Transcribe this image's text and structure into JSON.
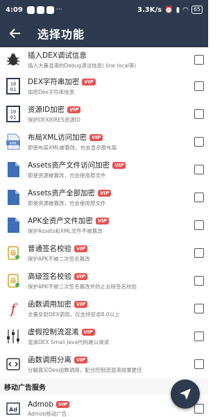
{
  "status": {
    "time": "4:09",
    "net_speed": "3.3K/s",
    "battery": "65"
  },
  "appbar": {
    "title": "选择功能"
  },
  "items": [
    {
      "title": "插入DEX调试信息",
      "desc": "插入大量混淆的Debug调试信息(.line local等)",
      "vip": false,
      "icon": "bug-icon"
    },
    {
      "title": "DEX字符串加密",
      "desc": "加密Dex字符串信息",
      "vip": true,
      "icon": "binary-file-icon"
    },
    {
      "title": "资源ID加密",
      "desc": "保护DEX的RES资源ID",
      "vip": true,
      "icon": "binary-file-icon"
    },
    {
      "title": "布局XML访问加密",
      "desc": "即使布局XML被篡改，也会显示原布局",
      "vip": true,
      "icon": "xml-file-icon"
    },
    {
      "title": "Assets资产文件访问加密",
      "desc": "即使资源被篡改，也会使用原文件",
      "vip": true,
      "icon": "file-icon"
    },
    {
      "title": "Assets资产全部加密",
      "desc": "即使资源被篡改，也会使用原文件",
      "vip": true,
      "icon": "file-icon"
    },
    {
      "title": "APK全资产文件加密",
      "desc": "保护Assets和XML文件不被篡改",
      "vip": true,
      "icon": "file-icon"
    },
    {
      "title": "普通签名校验",
      "desc": "保护APK不被二次签名篡改",
      "vip": true,
      "icon": "fingerprint-icon"
    },
    {
      "title": "高级签名校验",
      "desc": "保护APK不被二次签名篡改并防止去除签名校验",
      "vip": true,
      "icon": "fingerprint-icon"
    },
    {
      "title": "函数调用加密",
      "desc": "全量反射DEX调用，仅支持安卓8.0以上",
      "vip": true,
      "icon": "function-icon"
    },
    {
      "title": "虚假控制流混淆",
      "desc": "混淆DEX Smali Java代码难以阅读",
      "vip": true,
      "icon": "equalizer-icon"
    },
    {
      "title": "函数调用分离",
      "desc": "分解真实Dex函数调用，配合控制流混淆效果更佳",
      "vip": true,
      "icon": "code-icon"
    }
  ],
  "section": {
    "title": "移动广告服务"
  },
  "ad_item": {
    "title": "Admob",
    "desc": "Admob移动广告",
    "vip": true,
    "icon": "ad-icon"
  },
  "vip_label": "VIP"
}
